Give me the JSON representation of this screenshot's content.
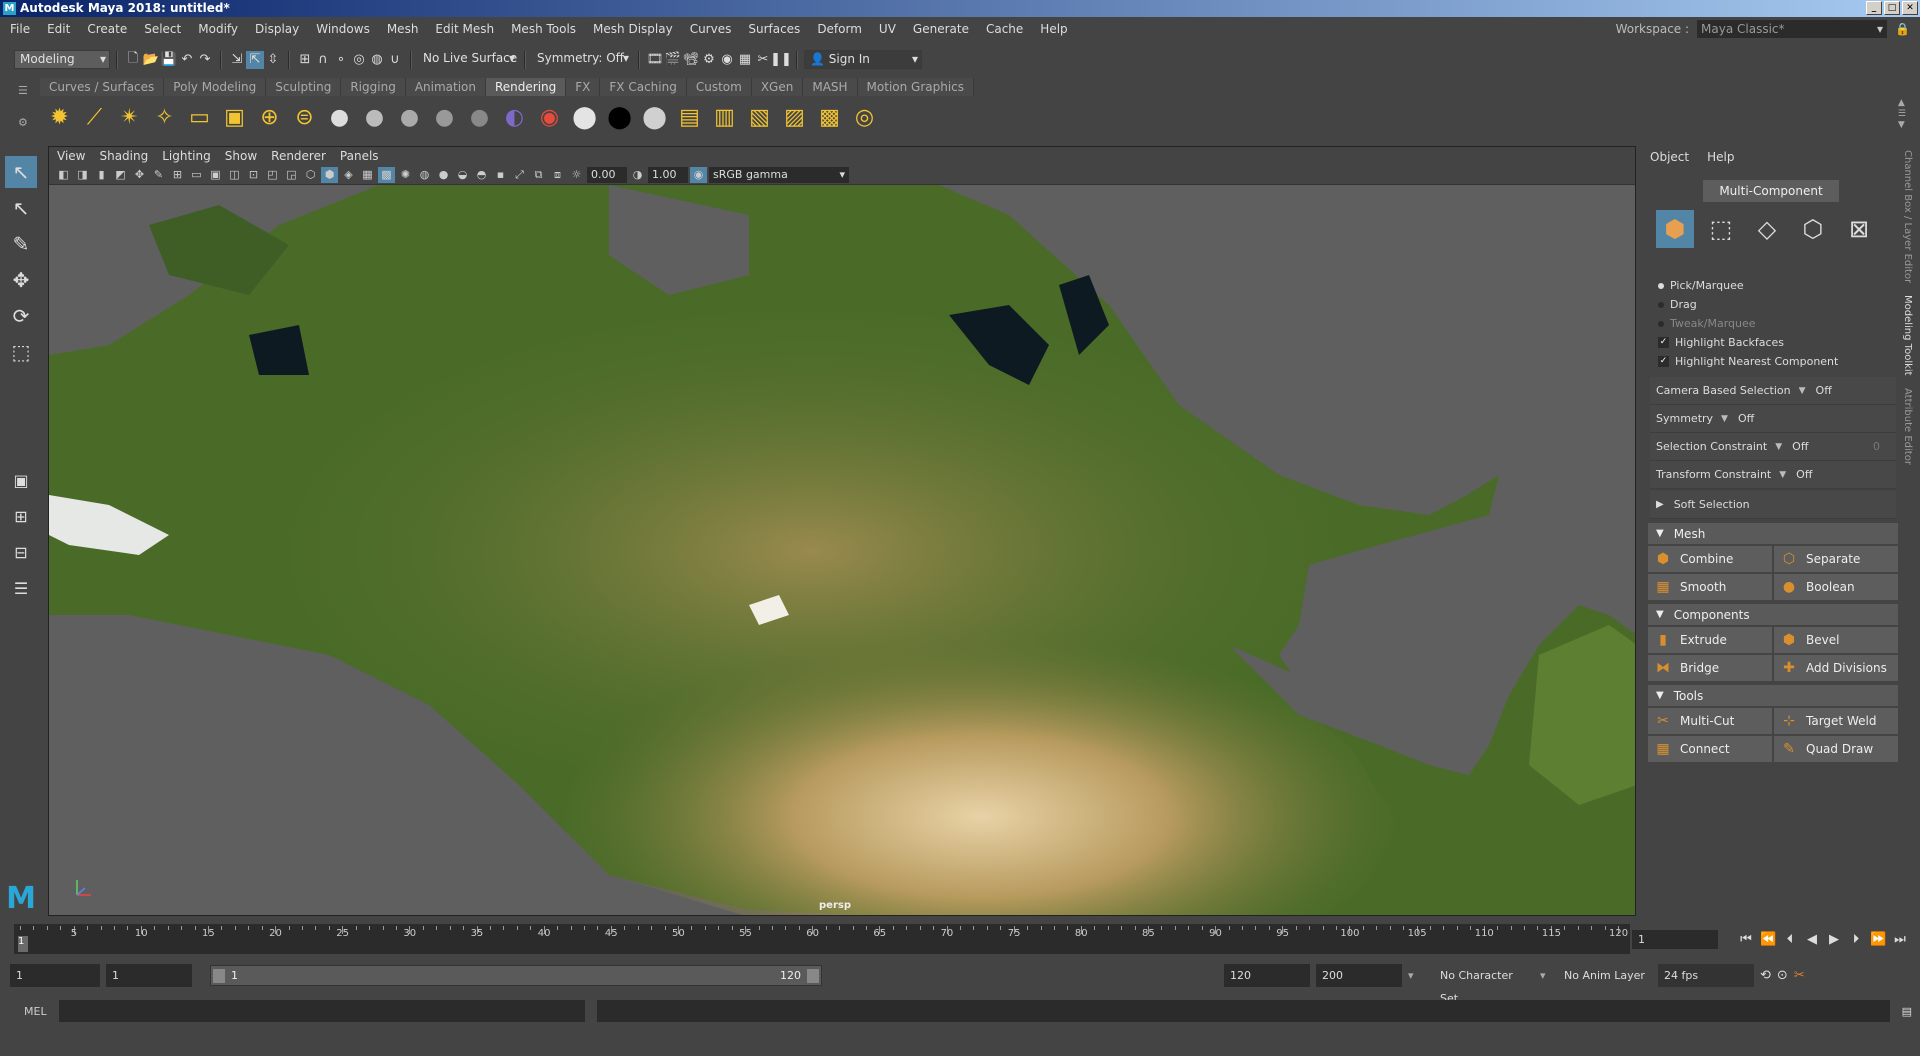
{
  "window": {
    "title": "Autodesk Maya 2018: untitled*"
  },
  "menu": [
    "File",
    "Edit",
    "Create",
    "Select",
    "Modify",
    "Display",
    "Windows",
    "Mesh",
    "Edit Mesh",
    "Mesh Tools",
    "Mesh Display",
    "Curves",
    "Surfaces",
    "Deform",
    "UV",
    "Generate",
    "Cache",
    "Help"
  ],
  "workspace": {
    "label": "Workspace :",
    "value": "Maya Classic*"
  },
  "status": {
    "menuset": "Modeling",
    "live_surface": "No Live Surface",
    "symmetry": "Symmetry: Off",
    "sign_in": "Sign In"
  },
  "shelf_tabs": [
    "Curves / Surfaces",
    "Poly Modeling",
    "Sculpting",
    "Rigging",
    "Animation",
    "Rendering",
    "FX",
    "FX Caching",
    "Custom",
    "XGen",
    "MASH",
    "Motion Graphics"
  ],
  "shelf_active": "Rendering",
  "viewport": {
    "menus": [
      "View",
      "Shading",
      "Lighting",
      "Show",
      "Renderer",
      "Panels"
    ],
    "exposure": "0.00",
    "gamma_value": "1.00",
    "color_space": "sRGB gamma",
    "camera": "persp"
  },
  "toolkit": {
    "menus": [
      "Object",
      "Help"
    ],
    "multi_component": "Multi-Component",
    "pick_marquee": "Pick/Marquee",
    "drag": "Drag",
    "tweak_marquee": "Tweak/Marquee",
    "highlight_backfaces": "Highlight Backfaces",
    "highlight_nearest": "Highlight Nearest Component",
    "camera_based": {
      "label": "Camera Based Selection",
      "value": "Off"
    },
    "symmetry": {
      "label": "Symmetry",
      "value": "Off"
    },
    "selection_constraint": {
      "label": "Selection Constraint",
      "value": "Off",
      "extra": "0"
    },
    "transform_constraint": {
      "label": "Transform Constraint",
      "value": "Off"
    },
    "soft_selection": "Soft Selection",
    "sections": {
      "mesh": {
        "title": "Mesh",
        "buttons": [
          "Combine",
          "Separate",
          "Smooth",
          "Boolean"
        ]
      },
      "components": {
        "title": "Components",
        "buttons": [
          "Extrude",
          "Bevel",
          "Bridge",
          "Add Divisions"
        ]
      },
      "tools": {
        "title": "Tools",
        "buttons": [
          "Multi-Cut",
          "Target Weld",
          "Connect",
          "Quad Draw"
        ]
      }
    }
  },
  "side_tabs": [
    "Channel Box / Layer Editor",
    "Modeling Toolkit",
    "Attribute Editor"
  ],
  "timeline": {
    "ticks": [
      "5",
      "10",
      "15",
      "20",
      "25",
      "30",
      "35",
      "40",
      "45",
      "50",
      "55",
      "60",
      "65",
      "70",
      "75",
      "80",
      "85",
      "90",
      "95",
      "100",
      "105",
      "110",
      "115",
      "120"
    ],
    "current": "1",
    "current_field": "1"
  },
  "range": {
    "start": "1",
    "anim_start": "1",
    "slider_start": "1",
    "slider_end": "120",
    "end": "120",
    "anim_end": "200",
    "character_set": "No Character Set",
    "anim_layer": "No Anim Layer",
    "fps": "24 fps"
  },
  "mel": {
    "label": "MEL"
  },
  "colors": {
    "accent": "#5285a6",
    "orange": "#d8902f",
    "bg": "#444444"
  }
}
